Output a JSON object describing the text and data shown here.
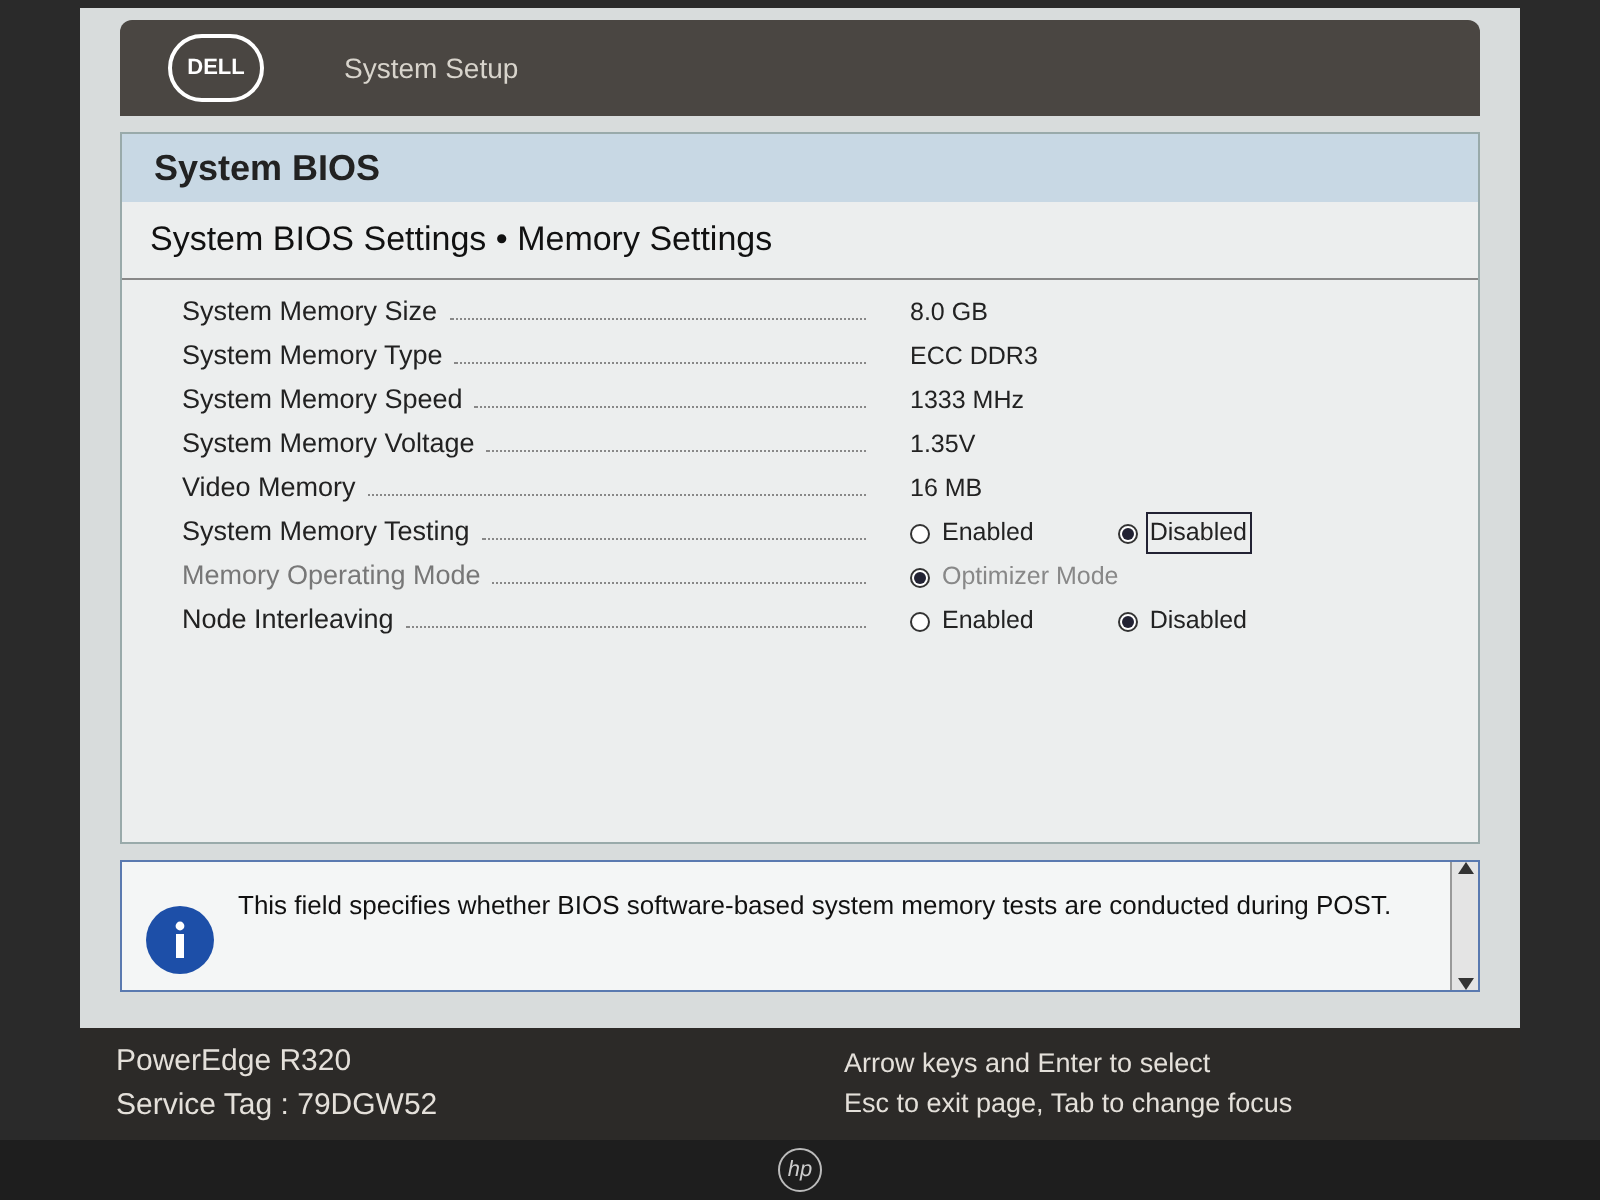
{
  "header": {
    "logo_text": "DELL",
    "title": "System Setup"
  },
  "panel": {
    "title": "System BIOS",
    "subtitle": "System BIOS Settings • Memory Settings"
  },
  "settings": [
    {
      "kind": "value",
      "label": "System Memory Size",
      "disabled": false,
      "value": "8.0 GB"
    },
    {
      "kind": "value",
      "label": "System Memory Type",
      "disabled": false,
      "value": "ECC DDR3"
    },
    {
      "kind": "value",
      "label": "System Memory Speed",
      "disabled": false,
      "value": "1333 MHz"
    },
    {
      "kind": "value",
      "label": "System Memory Voltage",
      "disabled": false,
      "value": "1.35V"
    },
    {
      "kind": "value",
      "label": "Video Memory",
      "disabled": false,
      "value": "16 MB"
    },
    {
      "kind": "radio",
      "label": "System Memory Testing",
      "disabled": false,
      "options": [
        {
          "label": "Enabled",
          "selected": false,
          "focused": false
        },
        {
          "label": "Disabled",
          "selected": true,
          "focused": true
        }
      ]
    },
    {
      "kind": "radio",
      "label": "Memory Operating Mode",
      "disabled": true,
      "options": [
        {
          "label": "Optimizer Mode",
          "selected": true,
          "focused": false
        }
      ]
    },
    {
      "kind": "radio",
      "label": "Node Interleaving",
      "disabled": false,
      "options": [
        {
          "label": "Enabled",
          "selected": false,
          "focused": false
        },
        {
          "label": "Disabled",
          "selected": true,
          "focused": false
        }
      ]
    }
  ],
  "help": {
    "text": "This field specifies whether BIOS software-based system memory tests are conducted during POST."
  },
  "footer": {
    "model": "PowerEdge R320",
    "service_tag": "Service Tag : 79DGW52",
    "hints": [
      "Arrow keys and Enter to select",
      "Esc to exit page, Tab to change focus"
    ]
  },
  "bezel": {
    "logo_text": "hp"
  }
}
